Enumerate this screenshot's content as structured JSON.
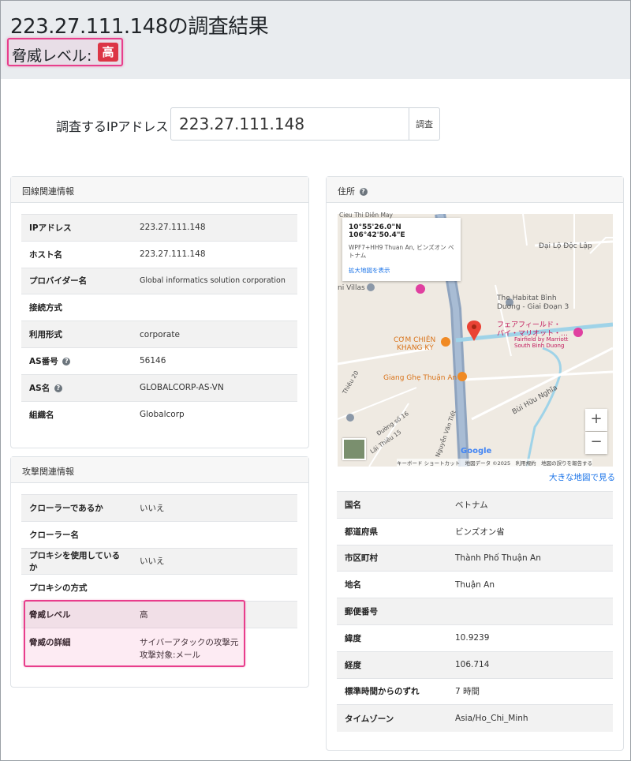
{
  "header": {
    "title": "223.27.111.148の調査結果",
    "threat_label": "脅威レベル:",
    "threat_badge": "高"
  },
  "search": {
    "label": "調査するIPアドレス",
    "value": "223.27.111.148",
    "button_label": "調査"
  },
  "line_info": {
    "title": "回線関連情報",
    "rows": [
      {
        "key": "IPアドレス",
        "value": "223.27.111.148"
      },
      {
        "key": "ホスト名",
        "value": "223.27.111.148"
      },
      {
        "key": "プロバイダー名",
        "value": "Global informatics solution corporation"
      },
      {
        "key": "接続方式",
        "value": ""
      },
      {
        "key": "利用形式",
        "value": "corporate"
      },
      {
        "key": "AS番号",
        "value": "56146"
      },
      {
        "key": "AS名",
        "value": "GLOBALCORP-AS-VN"
      },
      {
        "key": "組織名",
        "value": "Globalcorp"
      }
    ]
  },
  "attack_info": {
    "title": "攻撃関連情報",
    "rows": [
      {
        "key": "クローラーであるか",
        "value": "いいえ"
      },
      {
        "key": "クローラー名",
        "value": ""
      },
      {
        "key": "プロキシを使用しているか",
        "value": "いいえ"
      },
      {
        "key": "プロキシの方式",
        "value": ""
      },
      {
        "key": "脅威レベル",
        "value": "高"
      },
      {
        "key": "脅威の詳細",
        "value_line1": "サイバーアタックの攻撃元",
        "value_line2": "攻撃対象:メール"
      }
    ]
  },
  "address": {
    "title": "住所",
    "map": {
      "popup_coords": "10°55'26.0\"N 106°42'50.4\"E",
      "popup_address": "WPF7+HH9 Thuan An, ビンズオン ベトナム",
      "popup_link": "拡大地図を表示",
      "labels": {
        "dai_lo": "Đại Lộ Độc Lập",
        "habitat": "The Habitat Bình",
        "habitat2": "Dương - Giai Đoạn 3",
        "fairfield": "フェアフィールド・",
        "fairfield2": "バイ・マリオット・…",
        "fairfield_en": "Fairfield by Marriott",
        "fairfield_en2": "South Binh Duong",
        "com_chien": "CƠM CHIÊN",
        "com_chien2": "KHANG KỲ",
        "giang_ghe": "Giang Ghẹ Thuận An",
        "villas": "ni Villas",
        "bui_huu": "Bùi Hữu Nghĩa",
        "nguyen_van_tiet": "Nguyễn Văn Tiết",
        "duong_so": "Đường số 16",
        "lai_thieu": "Lái Thiêu 15",
        "thieu20": "Thiêu 20",
        "cieu": "Cieu Thi Diên May"
      },
      "google": "Google",
      "footer": "キーボード ショートカット　地図データ ©2025　利用規約　地図の誤りを報告する",
      "zoom_in": "+",
      "zoom_out": "−"
    },
    "big_map_link": "大きな地図で見る",
    "rows": [
      {
        "key": "国名",
        "value": "ベトナム"
      },
      {
        "key": "都道府県",
        "value": "ビンズオン省"
      },
      {
        "key": "市区町村",
        "value": "Thành Phố Thuận An"
      },
      {
        "key": "地名",
        "value": "Thuận An"
      },
      {
        "key": "郵便番号",
        "value": ""
      },
      {
        "key": "緯度",
        "value": "10.9239"
      },
      {
        "key": "経度",
        "value": "106.714"
      },
      {
        "key": "標準時間からのずれ",
        "value": "7 時間"
      },
      {
        "key": "タイムゾーン",
        "value": "Asia/Ho_Chi_Minh"
      }
    ]
  }
}
